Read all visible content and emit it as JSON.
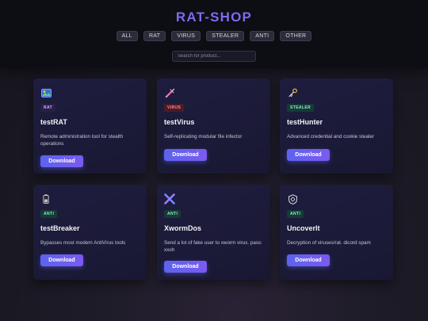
{
  "site": {
    "title": "RAT-SHOP"
  },
  "filters": [
    "ALL",
    "RAT",
    "VIRUS",
    "STEALER",
    "ANTI",
    "OTHER"
  ],
  "search": {
    "placeholder": "Search for product...",
    "value": ""
  },
  "download_label": "Download",
  "cards": [
    {
      "badge": "RAT",
      "name": "testRAT",
      "description": "Remote administration tool for stealth operations",
      "icon": "image-icon"
    },
    {
      "badge": "VIRUS",
      "name": "testVirus",
      "description": "Self-replicating modular file infector",
      "icon": "syringe-icon"
    },
    {
      "badge": "STEALER",
      "name": "testHunter",
      "description": "Advanced credential and cookie stealer",
      "icon": "key-icon"
    },
    {
      "badge": "ANTI",
      "name": "testBreaker",
      "description": "Bypasses most modern AntiVirus tools",
      "icon": "battery-icon"
    },
    {
      "badge": "ANTI",
      "name": "XwormDos",
      "description": "Send a lot of fake user to xworm virus. pass: xxoh",
      "icon": "x-logo-icon"
    },
    {
      "badge": "ANTI",
      "name": "UncoverIt",
      "description": "Decryption of viruses/rat. dicord spam",
      "icon": "virus-shield-icon"
    }
  ],
  "colors": {
    "accent": "#7b6cf0",
    "button": "#6a5ff0",
    "card": "#1e1d3e"
  }
}
